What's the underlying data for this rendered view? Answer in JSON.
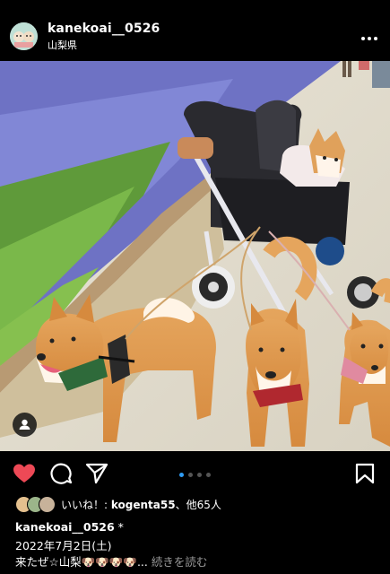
{
  "post": {
    "username": "kanekoai__0526",
    "location": "山梨県"
  },
  "photo": {
    "alt": "Four shiba inu dogs with a stroller beside a lavender field"
  },
  "icons": {
    "more": "more-horizontal-icon",
    "like": "heart-filled-icon",
    "comment": "comment-icon",
    "share": "paper-plane-icon",
    "save": "bookmark-icon",
    "tag": "user-tag-icon"
  },
  "carousel": {
    "count": 4,
    "active": 1
  },
  "likes": {
    "prefix": "いいね！: ",
    "user": "kogenta55",
    "suffix": "、他65人"
  },
  "caption": {
    "username": "kanekoai__0526",
    "star": " *",
    "date": "2022年7月2日(土)",
    "text": "来たぜ☆山梨🐶🐶🐶🐶...",
    "more": " 続きを読む"
  },
  "colors": {
    "like": "#ed4956",
    "active_dot": "#2f9cf4",
    "background": "#000000"
  }
}
